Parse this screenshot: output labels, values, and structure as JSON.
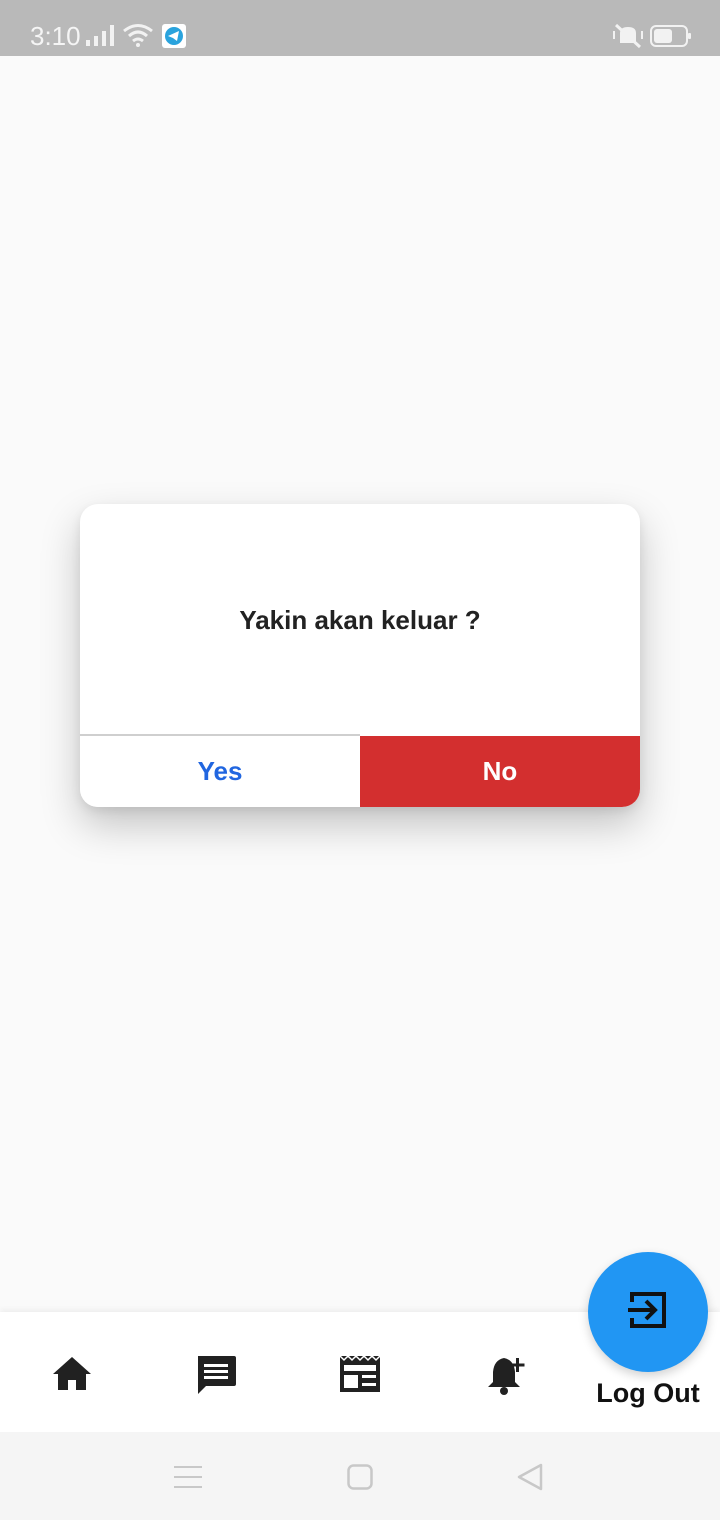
{
  "status_bar": {
    "time": "3:10",
    "icons": [
      "signal-icon",
      "wifi-icon",
      "telegram-icon",
      "vibrate-off-icon",
      "battery-icon"
    ]
  },
  "dialog": {
    "message": "Yakin akan keluar ?",
    "yes_label": "Yes",
    "no_label": "No"
  },
  "bottom_nav": {
    "items": [
      "home-icon",
      "message-icon",
      "news-icon",
      "notification-add-icon"
    ],
    "fab_icon": "logout-icon",
    "fab_label": "Log Out"
  },
  "system_nav": [
    "menu-icon",
    "home-square-icon",
    "back-triangle-icon"
  ],
  "colors": {
    "accent_blue": "#2196f3",
    "yes_text": "#2166e0",
    "no_button": "#d32f2f",
    "status_bar": "#b9b9b9"
  }
}
